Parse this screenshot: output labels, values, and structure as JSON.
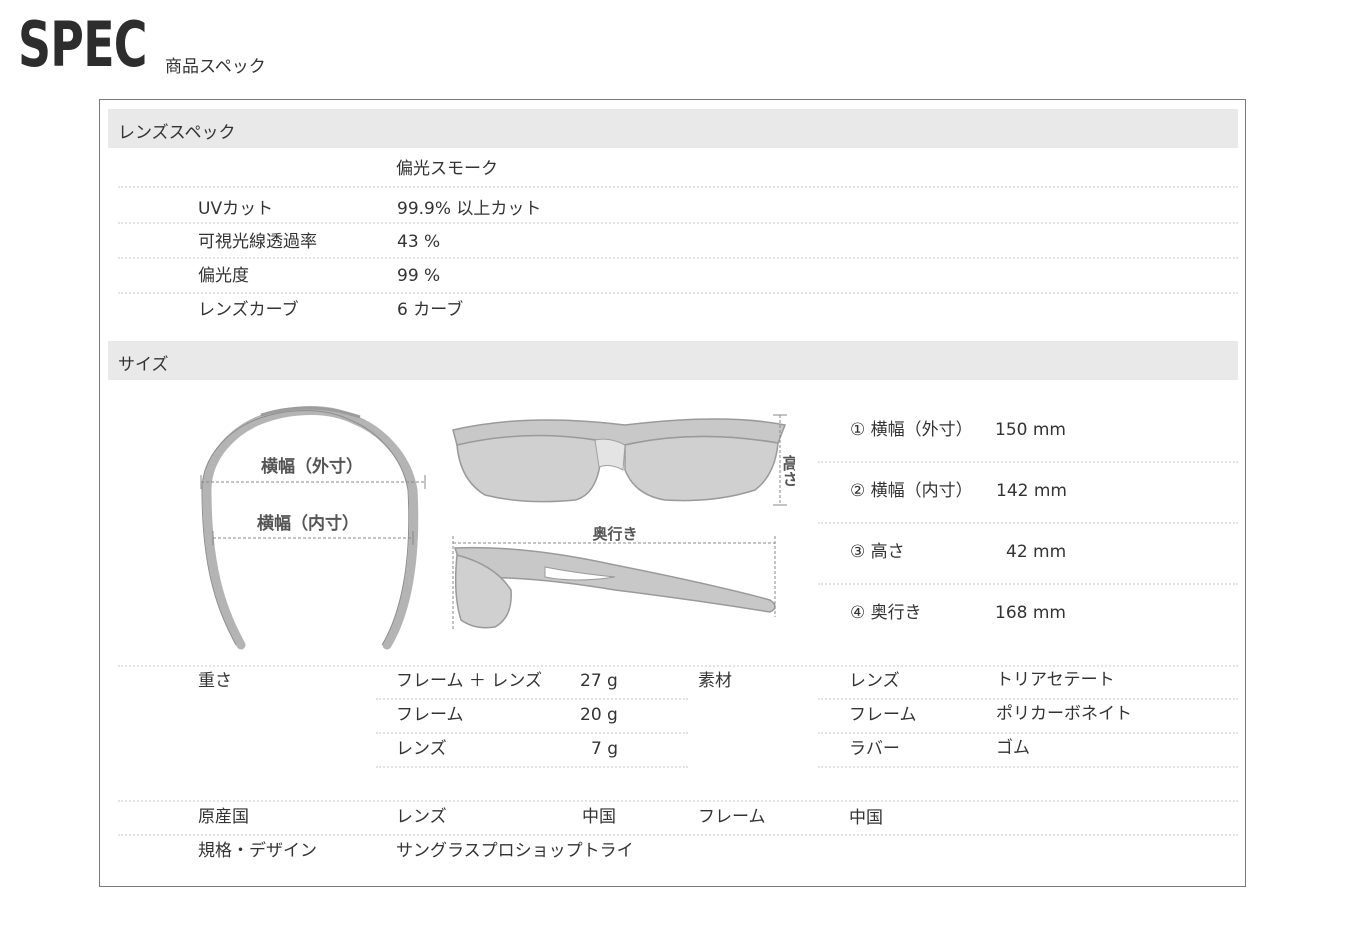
{
  "heading": {
    "title": "SPEC",
    "subtitle": "商品スペック"
  },
  "lens_spec": {
    "section_title": "レンズスペック",
    "lens_name": "偏光スモーク",
    "rows": [
      {
        "label": "UVカット",
        "value": "99.9% 以上カット"
      },
      {
        "label": "可視光線透過率",
        "value": "43 %"
      },
      {
        "label": "偏光度",
        "value": "99 %"
      },
      {
        "label": "レンズカーブ",
        "value": "6 カーブ"
      }
    ]
  },
  "size": {
    "section_title": "サイズ",
    "diagram_labels": {
      "outer_width": "横幅（外寸）",
      "inner_width": "横幅（内寸）",
      "height": "高さ",
      "depth": "奥行き"
    },
    "dimensions": [
      {
        "label": "① 横幅（外寸）",
        "value": "150 mm"
      },
      {
        "label": "② 横幅（内寸）",
        "value": "142 mm"
      },
      {
        "label": "③ 高さ",
        "value": "42 mm"
      },
      {
        "label": "④ 奥行き",
        "value": "168 mm"
      }
    ]
  },
  "weight": {
    "label": "重さ",
    "rows": [
      {
        "part": "フレーム ＋ レンズ",
        "value": "27 g"
      },
      {
        "part": "フレーム",
        "value": "20 g"
      },
      {
        "part": "レンズ",
        "value": "7 g"
      }
    ]
  },
  "material": {
    "label": "素材",
    "rows": [
      {
        "part": "レンズ",
        "value": "トリアセテート"
      },
      {
        "part": "フレーム",
        "value": "ポリカーボネイト"
      },
      {
        "part": "ラバー",
        "value": "ゴム"
      }
    ]
  },
  "origin": {
    "label": "原産国",
    "lens_label": "レンズ",
    "lens_value": "中国",
    "frame_label": "フレーム",
    "frame_value": "中国"
  },
  "design": {
    "label": "規格・デザイン",
    "value": "サングラスプロショップトライ"
  },
  "colors": {
    "section_bg": "#e9e9e9",
    "border": "#7a7a7a",
    "frame_gray": "#b4b4b4",
    "lens_gray": "#d0d0d0"
  }
}
